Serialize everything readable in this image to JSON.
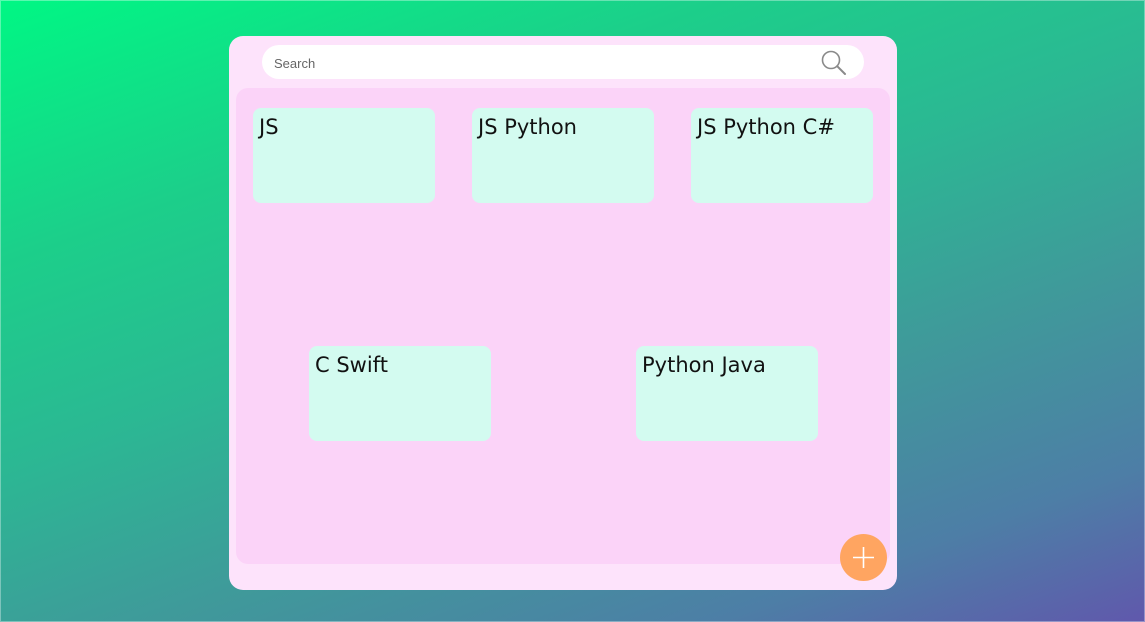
{
  "search": {
    "placeholder": "Search"
  },
  "notes": [
    {
      "text": "JS"
    },
    {
      "text": "JS Python"
    },
    {
      "text": "JS Python C#"
    },
    {
      "text": "C Swift"
    },
    {
      "text": "Python Java"
    }
  ],
  "icons": {
    "search": "search-icon",
    "add": "plus-icon"
  },
  "colors": {
    "app_background": "#fde3fb",
    "board_background": "#fbd3f8",
    "note_background": "#d3fbf0",
    "add_button": "#ffa561"
  }
}
